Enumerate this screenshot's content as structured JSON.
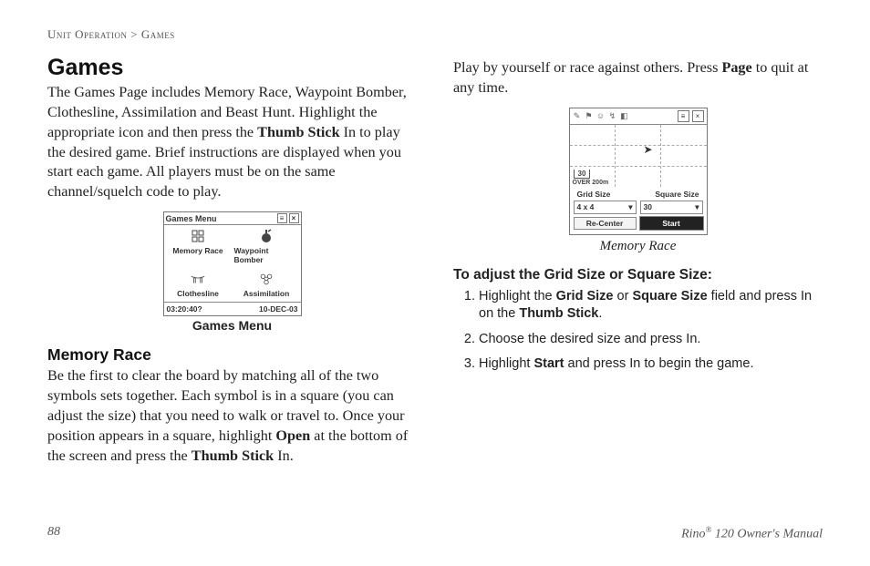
{
  "breadcrumb": {
    "section": "Unit Operation",
    "sep": ">",
    "page": "Games"
  },
  "h1": "Games",
  "intro_parts": {
    "p1": "The Games Page includes Memory Race, Waypoint Bomber, Clothesline, Assimilation and Beast Hunt. Highlight the appropriate icon and then press the ",
    "b1": "Thumb Stick",
    "p2": " In to play the desired game. Brief instructions are displayed when you start each game. All players must be on the same channel/squelch code to play."
  },
  "games_menu": {
    "title": "Games Menu",
    "items": [
      "Memory Race",
      "Waypoint Bomber",
      "Clothesline",
      "Assimilation"
    ],
    "time": "03:20:40?",
    "date": "10-DEC-03",
    "caption": "Games Menu"
  },
  "memory_heading": "Memory Race",
  "memory_para": {
    "p1": "Be the first to clear the board by matching all of the two symbols sets together. Each symbol is in a square (you can adjust the size) that you need to walk or travel to. Once your position appears in a square, highlight ",
    "b1": "Open",
    "p2": " at the bottom of the screen and press the ",
    "b2": "Thumb Stick",
    "p3": " In."
  },
  "right_intro": {
    "p1": "Play by yourself or race against others. Press ",
    "b1": "Page",
    "p2": " to quit at any time."
  },
  "memory_screen": {
    "scale_top": "30",
    "overshoot": "OVER 200m",
    "grid_label": "Grid Size",
    "square_label": "Square Size",
    "grid_value": "4 x 4",
    "square_value": "30",
    "recenter": "Re-Center",
    "start": "Start",
    "caption": "Memory Race"
  },
  "adjust_heading": "To adjust the Grid Size or Square Size:",
  "steps": {
    "s1a": "Highlight the ",
    "s1b": "Grid Size",
    "s1c": " or ",
    "s1d": "Square Size",
    "s1e": " field and press In on the ",
    "s1f": "Thumb Stick",
    "s1g": ".",
    "s2": "Choose the desired size and press In.",
    "s3a": "Highlight ",
    "s3b": "Start",
    "s3c": " and press In to begin the game."
  },
  "footer": {
    "page_no": "88",
    "product_a": "Rino",
    "product_b": "®",
    "product_c": " 120 Owner's Manual"
  }
}
